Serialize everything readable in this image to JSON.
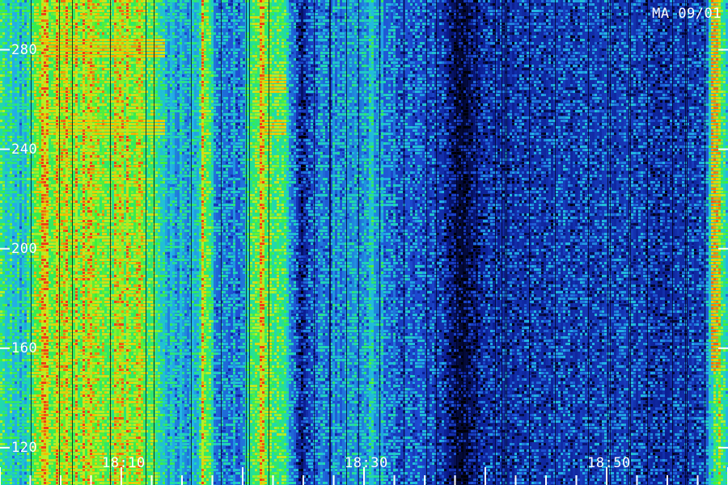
{
  "chart_data": {
    "type": "heatmap",
    "title": "MA 09/01",
    "xlabel": "",
    "ylabel": "",
    "x_tick_labels": [
      "18:10",
      "18:30",
      "18:50"
    ],
    "x_ticks": [
      {
        "label": "18:10",
        "value": 10
      },
      {
        "label": "18:30",
        "value": 30
      },
      {
        "label": "18:50",
        "value": 50
      }
    ],
    "xlim": [
      0,
      60
    ],
    "y_ticks": [
      120,
      160,
      200,
      240,
      280
    ],
    "ylim": [
      105,
      300
    ],
    "colormap": [
      "#000000",
      "#0a1a8c",
      "#1e4bd2",
      "#22b4e6",
      "#20dca8",
      "#3cf03c",
      "#b4f028",
      "#f0c800",
      "#f03c14"
    ],
    "intensity_profile": [
      {
        "x": 0.0,
        "level": 0.55
      },
      {
        "x": 2.0,
        "level": 0.45
      },
      {
        "x": 3.6,
        "level": 0.85
      },
      {
        "x": 7.0,
        "level": 0.82
      },
      {
        "x": 9.0,
        "level": 0.78
      },
      {
        "x": 11.5,
        "level": 0.8
      },
      {
        "x": 13.8,
        "level": 0.45
      },
      {
        "x": 16.3,
        "level": 0.4
      },
      {
        "x": 16.7,
        "level": 0.85
      },
      {
        "x": 17.8,
        "level": 0.4
      },
      {
        "x": 20.0,
        "level": 0.35
      },
      {
        "x": 21.5,
        "level": 0.85
      },
      {
        "x": 23.5,
        "level": 0.6
      },
      {
        "x": 24.8,
        "level": 0.1
      },
      {
        "x": 26.0,
        "level": 0.35
      },
      {
        "x": 29.0,
        "level": 0.4
      },
      {
        "x": 30.5,
        "level": 0.45
      },
      {
        "x": 33.0,
        "level": 0.3
      },
      {
        "x": 36.0,
        "level": 0.25
      },
      {
        "x": 38.0,
        "level": 0.05
      },
      {
        "x": 40.0,
        "level": 0.2
      },
      {
        "x": 45.0,
        "level": 0.22
      },
      {
        "x": 50.0,
        "level": 0.25
      },
      {
        "x": 55.0,
        "level": 0.2
      },
      {
        "x": 58.0,
        "level": 0.25
      },
      {
        "x": 58.8,
        "level": 0.6
      },
      {
        "x": 59.4,
        "level": 0.75
      },
      {
        "x": 60.0,
        "level": 0.35
      }
    ],
    "hotspots": [
      {
        "x": [
          3.5,
          13.5
        ],
        "y": [
          276,
          284
        ],
        "level": 0.92
      },
      {
        "x": [
          3.5,
          13.5
        ],
        "y": [
          246,
          252
        ],
        "level": 0.9
      },
      {
        "x": [
          21.5,
          23.5
        ],
        "y": [
          262,
          270
        ],
        "level": 0.92
      },
      {
        "x": [
          21.5,
          23.5
        ],
        "y": [
          246,
          252
        ],
        "level": 0.92
      },
      {
        "x": [
          58.6,
          59.2
        ],
        "y": [
          150,
          300
        ],
        "level": 0.97
      }
    ]
  }
}
